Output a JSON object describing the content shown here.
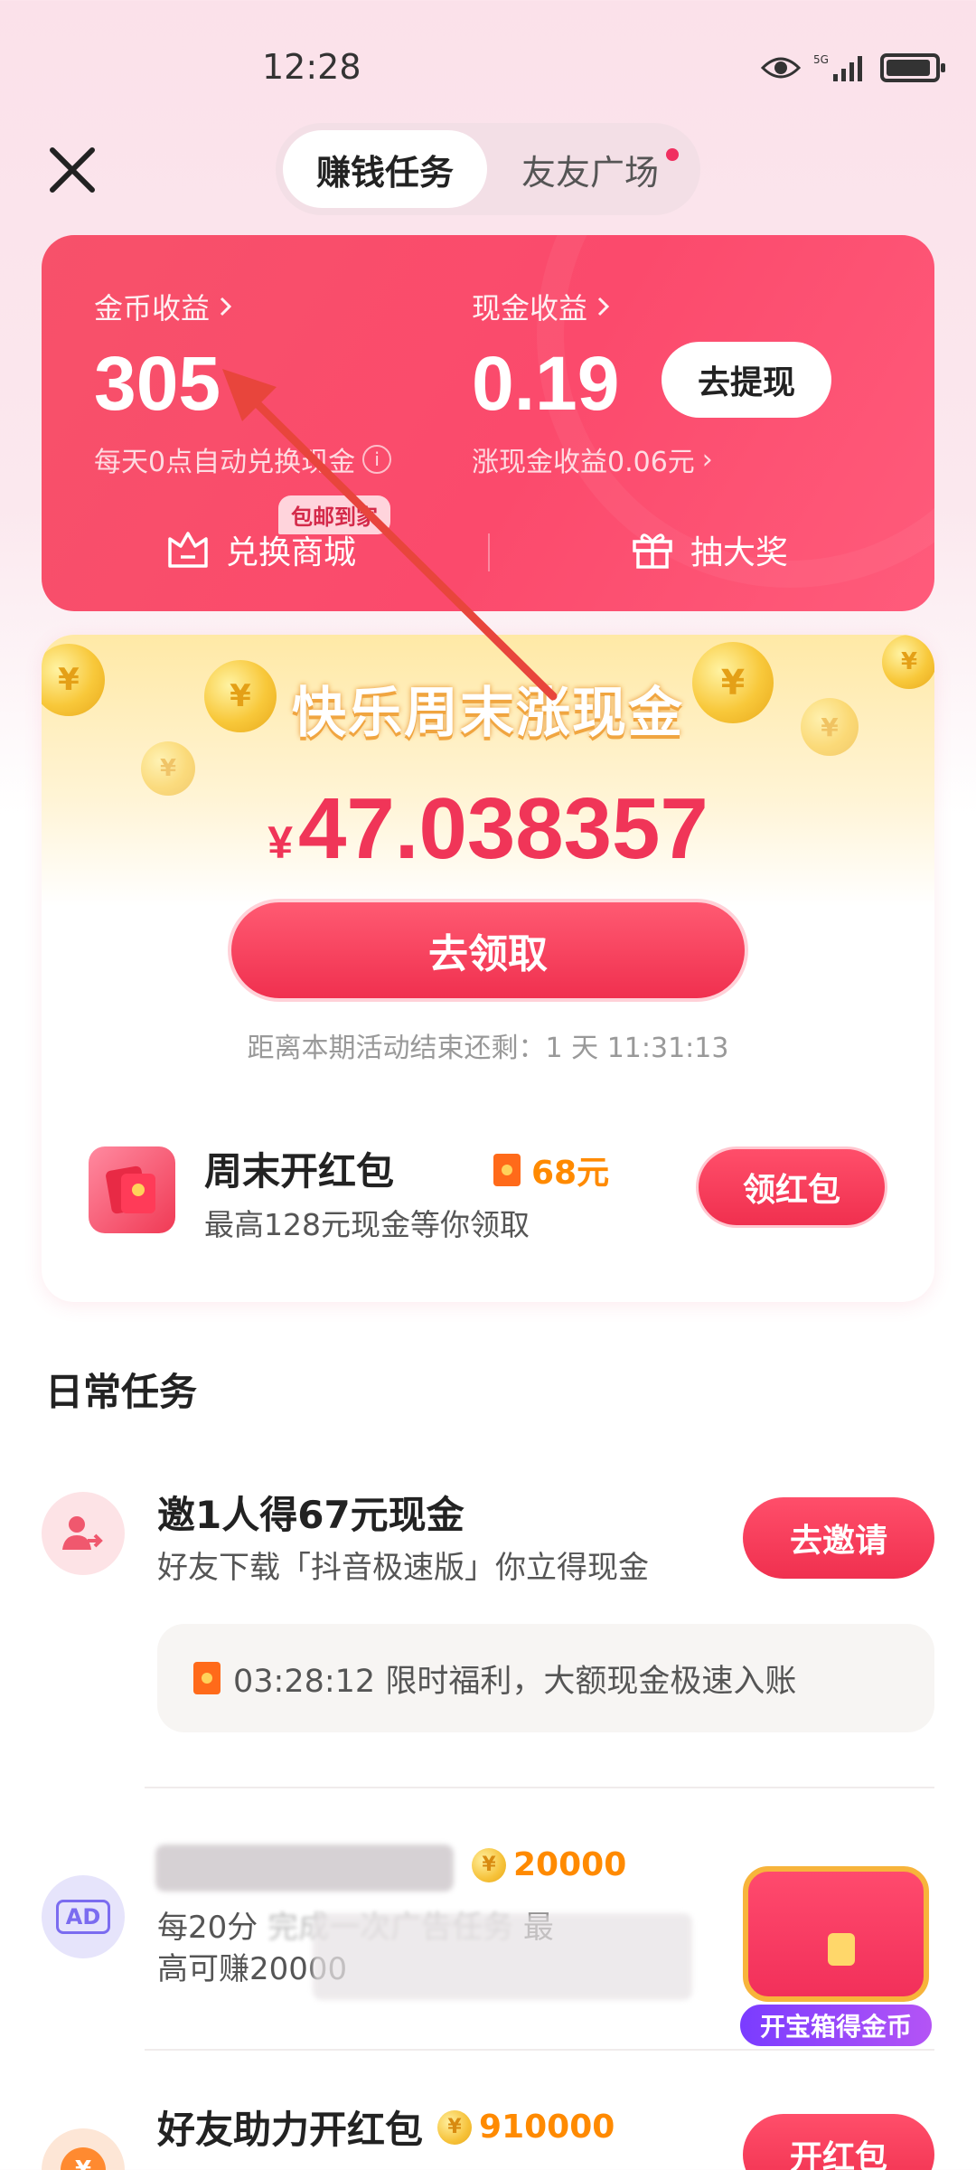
{
  "status_bar": {
    "time": "12:28",
    "network": "5G"
  },
  "header": {
    "close_icon": "close-icon",
    "tabs": [
      {
        "label": "赚钱任务",
        "active": true
      },
      {
        "label": "友友广场",
        "active": false,
        "has_dot": true
      }
    ]
  },
  "earnings": {
    "coin_label": "金币收益",
    "coin_value": "305",
    "coin_sub": "每天0点自动兑换现金",
    "cash_label": "现金收益",
    "cash_value": "0.19",
    "cash_sub": "涨现金收益0.06元",
    "withdraw_label": "去提现",
    "shop_label": "兑换商城",
    "shop_badge": "包邮到家",
    "lottery_label": "抽大奖"
  },
  "weekend": {
    "title": "快乐周末涨现金",
    "currency": "¥",
    "amount": "47.038357",
    "claim_label": "去领取",
    "countdown": "距离本期活动结束还剩：1 天 11:31:13",
    "redpack": {
      "title": "周末开红包",
      "price": "68元",
      "subtitle": "最高128元现金等你领取",
      "button": "领红包"
    }
  },
  "daily": {
    "title": "日常任务",
    "tasks": [
      {
        "title": "邀1人得67元现金",
        "subtitle": "好友下载「抖音极速版」你立得现金",
        "button": "去邀请",
        "notice": "03:28:12 限时福利，大额现金极速入账"
      },
      {
        "coins": "20000",
        "icon_text": "AD",
        "subtitle_line1": "每20分",
        "subtitle_mid": "完成一次广告任务",
        "subtitle_end": "最",
        "subtitle_line2": "高可赚20000"
      },
      {
        "title": "好友助力开红包",
        "coins": "910000",
        "button": "开红包"
      }
    ],
    "treasure_label": "开宝箱得金币"
  },
  "colors": {
    "accent": "#f0304f",
    "coin": "#ff8a00",
    "card": "#f7516a"
  }
}
